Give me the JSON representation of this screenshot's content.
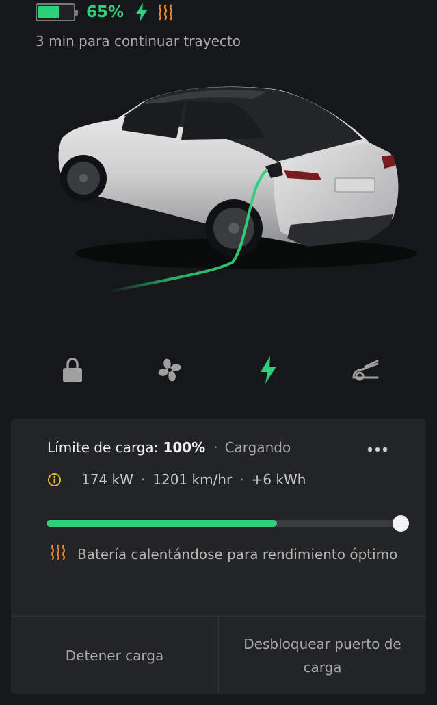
{
  "status": {
    "battery_level": 0.65,
    "battery_percent": "65%",
    "charging_icon": "bolt-icon",
    "battery_heat_icon": "heat-icon"
  },
  "trip_status": "3 min para continuar trayecto",
  "vehicle_image": "car-charging-image",
  "controls": [
    {
      "name": "lock-icon"
    },
    {
      "name": "fan-icon"
    },
    {
      "name": "bolt-icon"
    },
    {
      "name": "frunk-icon"
    }
  ],
  "charge": {
    "limit_label": "Límite de carga:",
    "limit_value": "100%",
    "separator": "·",
    "state": "Cargando",
    "power": "174 kW",
    "rate": "1201 km/hr",
    "energy_added": "+6 kWh",
    "battery_level": 0.65,
    "charge_limit": 1.0,
    "heat_message": "Batería calentándose para rendimiento óptimo",
    "stop_button": "Detener carga",
    "unlock_button": "Desbloquear puerto de carga"
  },
  "colors": {
    "accent_green": "#2fd07c",
    "heat_orange": "#e9892f",
    "info_yellow": "#f0b429",
    "background": "#161718",
    "card": "#232425"
  }
}
